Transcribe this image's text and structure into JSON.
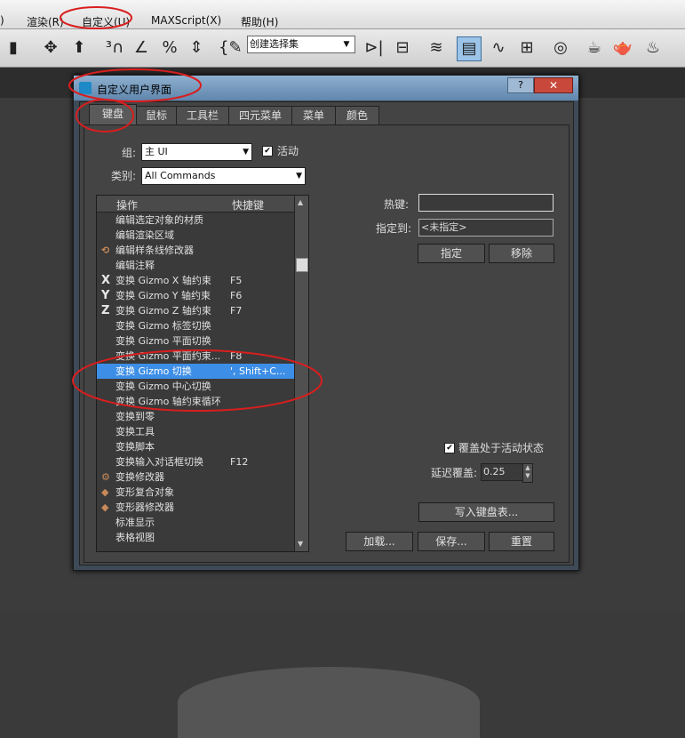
{
  "menubar": {
    "items": [
      ")",
      "渲染(R)",
      "自定义(U)",
      "MAXScript(X)",
      "帮助(H)"
    ]
  },
  "toolbar": {
    "selection_set_placeholder": "创建选择集"
  },
  "dialog": {
    "title": "自定义用户界面",
    "help_label": "?",
    "close_label": "✕",
    "tabs": [
      "键盘",
      "鼠标",
      "工具栏",
      "四元菜单",
      "菜单",
      "颜色"
    ],
    "group_label": "组:",
    "group_value": "主 UI",
    "active_label": "活动",
    "category_label": "类别:",
    "category_value": "All Commands",
    "list_headers": {
      "action": "操作",
      "shortcut": "快捷键"
    },
    "actions": [
      {
        "icon": "",
        "name": "编辑选定对象的材质",
        "shortcut": ""
      },
      {
        "icon": "",
        "name": "编辑渲染区域",
        "shortcut": ""
      },
      {
        "icon": "spline-modifier-icon",
        "name": "编辑样条线修改器",
        "shortcut": ""
      },
      {
        "icon": "",
        "name": "编辑注释",
        "shortcut": ""
      },
      {
        "icon": "X",
        "name": "变换 Gizmo X 轴约束",
        "shortcut": "F5"
      },
      {
        "icon": "Y",
        "name": "变换 Gizmo Y 轴约束",
        "shortcut": "F6"
      },
      {
        "icon": "Z",
        "name": "变换 Gizmo Z 轴约束",
        "shortcut": "F7"
      },
      {
        "icon": "",
        "name": "变换 Gizmo 标签切换",
        "shortcut": ""
      },
      {
        "icon": "",
        "name": "变换 Gizmo 平面切换",
        "shortcut": ""
      },
      {
        "icon": "",
        "name": "变换 Gizmo 平面约束...",
        "shortcut": "F8"
      },
      {
        "icon": "",
        "name": "变换 Gizmo 切换",
        "shortcut": "', Shift+C..."
      },
      {
        "icon": "",
        "name": "变换 Gizmo 中心切换",
        "shortcut": ""
      },
      {
        "icon": "",
        "name": "变换 Gizmo 轴约束循环",
        "shortcut": ""
      },
      {
        "icon": "",
        "name": "变换到零",
        "shortcut": ""
      },
      {
        "icon": "",
        "name": "变换工具",
        "shortcut": ""
      },
      {
        "icon": "",
        "name": "变换脚本",
        "shortcut": ""
      },
      {
        "icon": "",
        "name": "变换输入对话框切换",
        "shortcut": "F12"
      },
      {
        "icon": "modifier-icon",
        "name": "变换修改器",
        "shortcut": ""
      },
      {
        "icon": "morph-compound-icon",
        "name": "变形复合对象",
        "shortcut": ""
      },
      {
        "icon": "morpher-icon",
        "name": "变形器修改器",
        "shortcut": ""
      },
      {
        "icon": "",
        "name": "标准显示",
        "shortcut": ""
      },
      {
        "icon": "",
        "name": "表格视图",
        "shortcut": ""
      }
    ],
    "selected_index": 10,
    "hotkey_label": "热键:",
    "hotkey_value": "",
    "assigned_to_label": "指定到:",
    "assigned_to_value": "<未指定>",
    "assign_btn": "指定",
    "remove_btn": "移除",
    "override_label": "覆盖处于活动状态",
    "delay_label": "延迟覆盖:",
    "delay_value": "0.25",
    "write_btn": "写入键盘表...",
    "load_btn": "加载...",
    "save_btn": "保存...",
    "reset_btn": "重置"
  },
  "annotation_color": "#d91e1e"
}
